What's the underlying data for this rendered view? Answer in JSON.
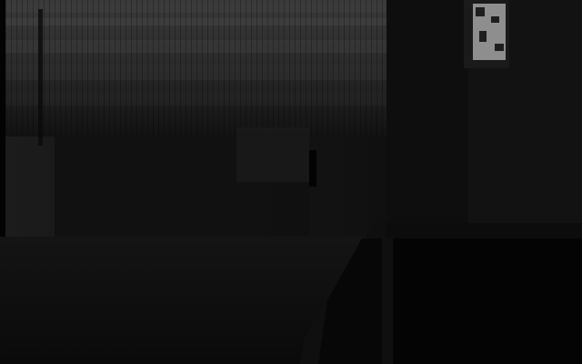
{
  "image": {
    "kind": "depth-map-frame",
    "colors": {
      "background": "#0a0a0a",
      "ceiling_band": "#2a2a2a",
      "ceiling_bright": "#4a4a4a",
      "wall_left": "#151515",
      "floor": "#0d0d0d",
      "door_panel": "#121212",
      "door_lower": "#050505",
      "window_glare": "#9a9a9a"
    }
  }
}
